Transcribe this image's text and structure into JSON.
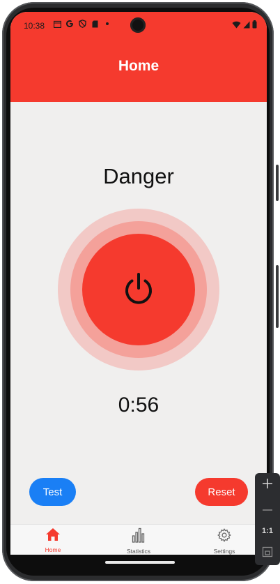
{
  "status_bar": {
    "time": "10:38"
  },
  "header": {
    "title": "Home"
  },
  "main": {
    "state_label": "Danger",
    "timer": "0:56"
  },
  "actions": {
    "test_label": "Test",
    "reset_label": "Reset"
  },
  "bottom_nav": {
    "items": [
      {
        "label": "Home",
        "icon": "home-icon",
        "active": true
      },
      {
        "label": "Statistics",
        "icon": "bar-chart-icon",
        "active": false
      },
      {
        "label": "Settings",
        "icon": "gear-icon",
        "active": false
      }
    ]
  },
  "emulator_toolbar": {
    "aspect_label": "1:1"
  },
  "colors": {
    "accent_red": "#f53a2e",
    "accent_blue": "#1a7ff5",
    "ring_light": "#f2c9c6",
    "ring_mid": "#f4a19a",
    "background": "#f0efee"
  }
}
